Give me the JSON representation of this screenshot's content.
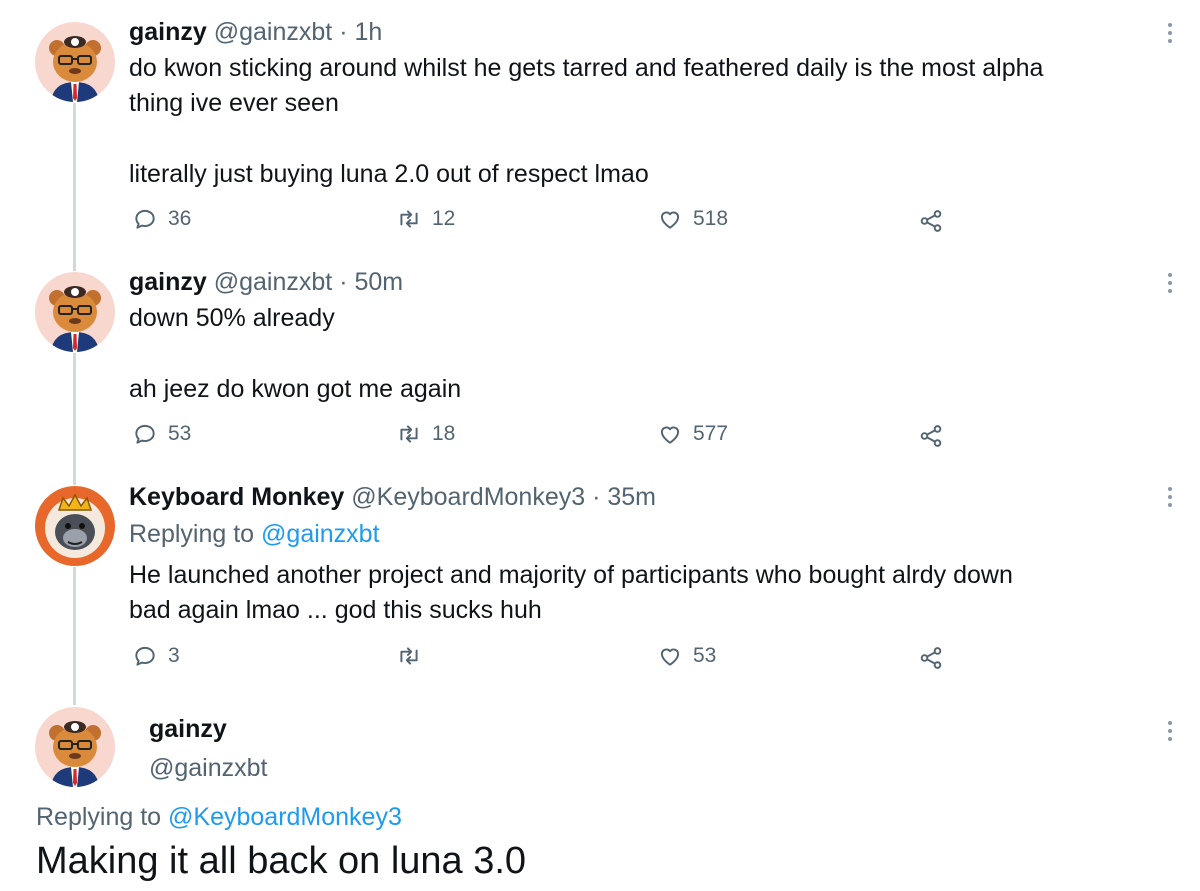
{
  "colors": {
    "accent": "#1d9bf0",
    "muted": "#536471",
    "text": "#0f1419",
    "thread": "#cfd9de"
  },
  "tweets": [
    {
      "name": "gainzy",
      "handle": "@gainzxbt",
      "time": "· 1h",
      "lines": [
        "do kwon sticking around whilst he gets tarred and feathered daily is the most alpha",
        "thing ive ever seen",
        "",
        "literally just buying luna 2.0 out of respect lmao"
      ],
      "replies": "36",
      "retweets": "12",
      "likes": "518",
      "avatar": "hamster-avatar"
    },
    {
      "name": "gainzy",
      "handle": "@gainzxbt",
      "time": "· 50m",
      "lines": [
        "down 50% already",
        "",
        "ah jeez do kwon got me again"
      ],
      "replies": "53",
      "retweets": "18",
      "likes": "577",
      "avatar": "hamster-avatar"
    },
    {
      "name": "Keyboard Monkey",
      "handle": "@KeyboardMonkey3",
      "time": "· 35m",
      "replying_label": "Replying to",
      "replying_to": "@gainzxbt",
      "lines": [
        "He launched another project and majority of participants who bought alrdy down",
        "bad again lmao ... god this sucks huh"
      ],
      "replies": "3",
      "retweets": "",
      "likes": "53",
      "avatar": "gorilla-king-avatar"
    }
  ],
  "main_tweet": {
    "name": "gainzy",
    "handle": "@gainzxbt",
    "replying_label": "Replying to",
    "replying_to": "@KeyboardMonkey3",
    "text": "Making it all back on luna 3.0",
    "avatar": "hamster-avatar"
  },
  "icons": [
    "reply-icon",
    "retweet-icon",
    "like-icon",
    "share-icon",
    "more-icon"
  ]
}
